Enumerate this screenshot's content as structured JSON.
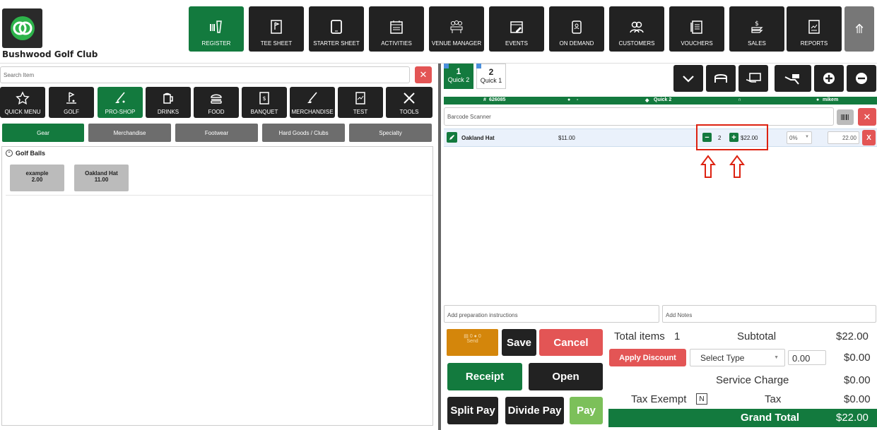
{
  "club_name": "Bushwood Golf Club",
  "nav": [
    "REGISTER",
    "TEE SHEET",
    "STARTER SHEET",
    "ACTIVITIES",
    "VENUE MANAGER",
    "EVENTS",
    "ON DEMAND",
    "CUSTOMERS",
    "VOUCHERS",
    "SALES",
    "REPORTS"
  ],
  "search_placeholder": "Search Item",
  "categories": [
    "QUICK MENU",
    "GOLF",
    "PRO-SHOP",
    "DRINKS",
    "FOOD",
    "BANQUET",
    "MERCHANDISE",
    "TEST",
    "TOOLS"
  ],
  "subcategories": [
    "Gear",
    "Merchandise",
    "Footwear",
    "Hard Goods / Clubs",
    "Specialty"
  ],
  "group_title": "Golf Balls",
  "tiles": [
    {
      "name": "example",
      "price": "2.00"
    },
    {
      "name": "Oakland Hat",
      "price": "11.00"
    }
  ],
  "tabs": [
    {
      "num": "1",
      "label": "Quick 2"
    },
    {
      "num": "2",
      "label": "Quick 1"
    }
  ],
  "order_bar": {
    "id": "626085",
    "customer": "-",
    "ticket": "Quick 2",
    "user": "mikem"
  },
  "barcode_placeholder": "Barcode Scanner",
  "item": {
    "name": "Oakland Hat",
    "price": "$11.00",
    "qty": "2",
    "total": "$22.00",
    "discount": "0%",
    "line": "22.00",
    "remove": "X"
  },
  "prep_placeholder": "Add preparation instructions",
  "notes_placeholder": "Add Notes",
  "buttons": {
    "send": "Send",
    "save": "Save",
    "cancel": "Cancel",
    "receipt": "Receipt",
    "open": "Open",
    "split": "Split Pay",
    "divide": "Divide Pay",
    "pay": "Pay",
    "apply_discount": "Apply Discount",
    "select_type": "Select Type"
  },
  "summary": {
    "total_items_label": "Total items",
    "total_items": "1",
    "subtotal_label": "Subtotal",
    "subtotal": "$22.00",
    "discount_input": "0.00",
    "discount_value": "$0.00",
    "service_label": "Service Charge",
    "service": "$0.00",
    "tax_exempt_label": "Tax Exempt",
    "tax_exempt_flag": "N",
    "tax_label": "Tax",
    "tax": "$0.00",
    "grand_label": "Grand Total",
    "grand": "$22.00"
  },
  "colors": {
    "green": "#137a3e",
    "dark": "#222222",
    "red": "#e35555",
    "orange": "#d4860b",
    "light_green": "#7cc05a"
  }
}
